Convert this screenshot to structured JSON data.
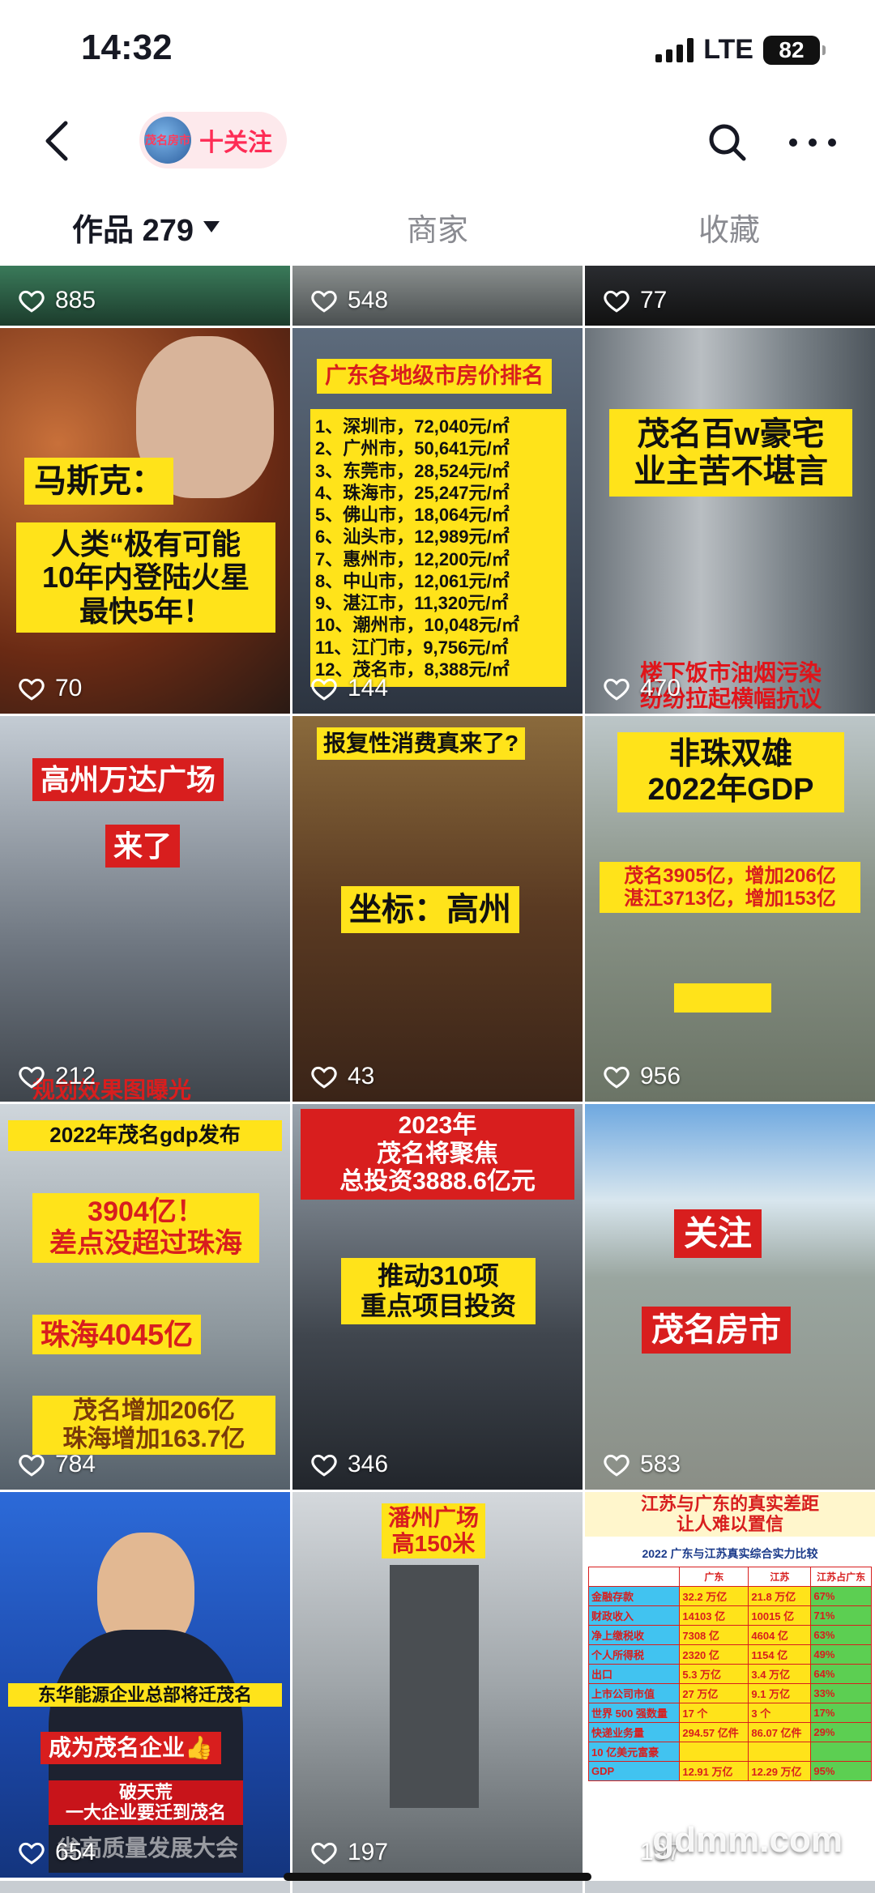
{
  "status_bar": {
    "time": "14:32",
    "network": "LTE",
    "battery": "82"
  },
  "nav": {
    "follow_label": "十关注",
    "avatar_text": "茂名房市"
  },
  "tabs": [
    {
      "label": "作品 279",
      "active": true
    },
    {
      "label": "商家",
      "active": false
    },
    {
      "label": "收藏",
      "active": false
    }
  ],
  "partial_row": {
    "likes": [
      "885",
      "548",
      "77"
    ]
  },
  "videos": [
    {
      "likes": "70",
      "captions": [
        "马斯克：",
        "人类“极有可能\n10年内登陆火星\n最快5年！"
      ]
    },
    {
      "likes": "144",
      "captions": [
        "广东各地级市房价排名",
        "1、深圳市，72,040元/㎡\n2、广州市，50,641元/㎡\n3、东莞市，28,524元/㎡\n4、珠海市，25,247元/㎡\n5、佛山市，18,064元/㎡\n6、汕头市，12,989元/㎡\n7、惠州市，12,200元/㎡\n8、中山市，12,061元/㎡\n9、湛江市，11,320元/㎡\n10、潮州市，10,048元/㎡\n11、江门市，9,756元/㎡\n12、茂名市，8,388元/㎡"
      ]
    },
    {
      "likes": "470",
      "captions": [
        "茂名百w豪宅\n业主苦不堪言",
        "楼下饭市油烟污染\n纷纷拉起横幅抗议"
      ]
    },
    {
      "likes": "212",
      "captions": [
        "高州万达广场",
        "来了",
        "规划效果图曝光"
      ]
    },
    {
      "likes": "43",
      "captions": [
        "报复性消费真来了?",
        "坐标：高州"
      ]
    },
    {
      "likes": "956",
      "captions": [
        "非珠双雄\n2022年GDP",
        "茂名3905亿，增加206亿\n湛江3713亿，增加153亿"
      ]
    },
    {
      "likes": "784",
      "captions": [
        "2022年茂名gdp发布",
        "3904亿！\n差点没超过珠海",
        "珠海4045亿",
        "茂名增加206亿\n珠海增加163.7亿"
      ]
    },
    {
      "likes": "346",
      "captions": [
        "2023年\n茂名将聚焦\n总投资3888.6亿元",
        "推动310项\n重点项目投资"
      ]
    },
    {
      "likes": "583",
      "captions": [
        "关注",
        "茂名房市"
      ]
    },
    {
      "likes": "654",
      "captions": [
        "东华能源企业总部将迁茂名",
        "成为茂名企业👍",
        "破天荒\n一大企业要迁到茂名",
        "省高质量发展大会"
      ]
    },
    {
      "likes": "197",
      "captions": [
        "潘州广场\n高150米"
      ]
    },
    {
      "likes": "197",
      "captions": [
        "江苏与广东的真实差距\n让人难以置信",
        "2022 广东与江苏真实综合实力比较"
      ]
    }
  ],
  "table": {
    "headers": [
      "",
      "广东",
      "江苏",
      "江苏占广东"
    ],
    "rows": [
      [
        "金融存款",
        "32.2 万亿",
        "21.8 万亿",
        "67%"
      ],
      [
        "财政收入",
        "14103 亿",
        "10015 亿",
        "71%"
      ],
      [
        "净上缴税收",
        "7308 亿",
        "4604 亿",
        "63%"
      ],
      [
        "个人所得税",
        "2320 亿",
        "1154 亿",
        "49%"
      ],
      [
        "出口",
        "5.3 万亿",
        "3.4 万亿",
        "64%"
      ],
      [
        "上市公司市值",
        "27 万亿",
        "9.1 万亿",
        "33%"
      ],
      [
        "世界 500 强数量",
        "17 个",
        "3 个",
        "17%"
      ],
      [
        "快递业务量",
        "294.57 亿件",
        "86.07 亿件",
        "29%"
      ],
      [
        "10 亿美元富豪",
        "",
        "",
        ""
      ],
      [
        "GDP",
        "12.91 万亿",
        "12.29 万亿",
        "95%"
      ]
    ]
  },
  "watermark": "gdmm.com"
}
